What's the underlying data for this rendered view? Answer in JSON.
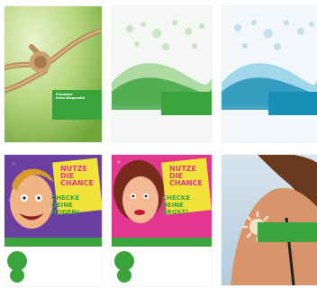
{
  "brand": {
    "green": "#3aa33c",
    "teal": "#1a8fb5",
    "pink": "#e2368f",
    "purple": "#6b3fa0"
  },
  "cards": [
    {
      "id": "rope",
      "title": "Pränatale\nfrühe Diagnostik",
      "sub": "",
      "foot": ""
    },
    {
      "id": "green-wave",
      "title": "",
      "sub": "",
      "foot": ""
    },
    {
      "id": "blue-wave",
      "title": "",
      "sub": "",
      "foot": ""
    },
    {
      "id": "comic-man",
      "headline": "NUTZE DIE\nCHANCE",
      "subline": "CHECKE DEINE\nHODEN!",
      "badge": ""
    },
    {
      "id": "comic-woman",
      "headline": "NUTZE DIE\nCHANCE",
      "subline": "CHECKE DEINE\nBRUST!",
      "badge": ""
    },
    {
      "id": "beach",
      "title": ""
    }
  ]
}
